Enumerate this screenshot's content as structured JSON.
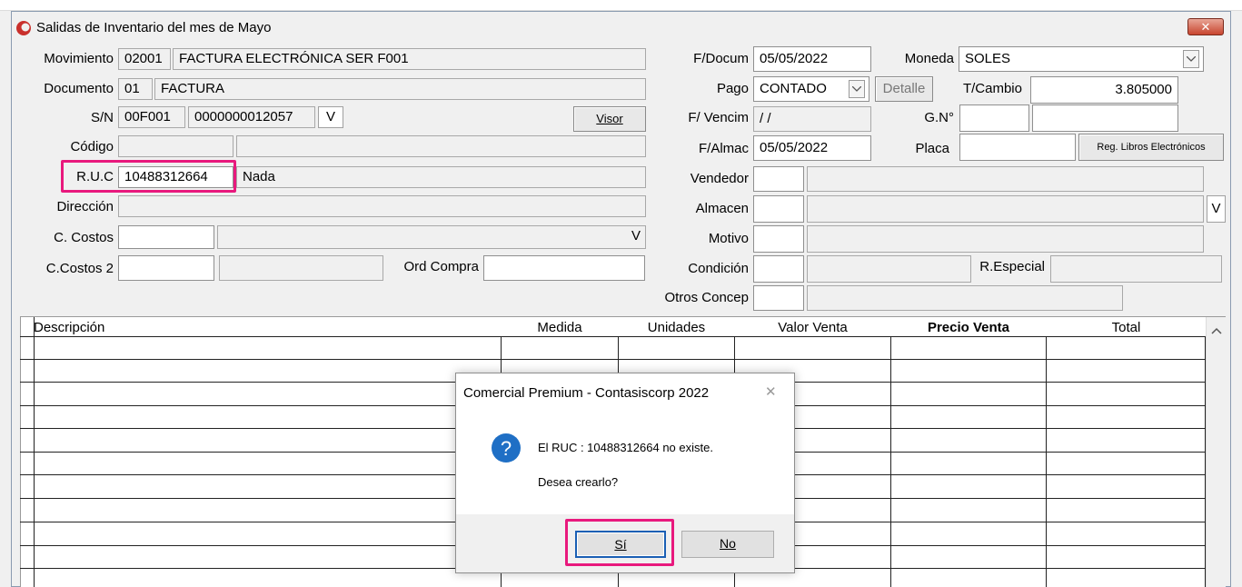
{
  "window": {
    "title": "Salidas de Inventario del mes de Mayo",
    "close": "✕"
  },
  "form": {
    "movimiento": {
      "label": "Movimiento",
      "code": "02001",
      "desc": "FACTURA ELECTRÓNICA SER F001"
    },
    "documento": {
      "label": "Documento",
      "code": "01",
      "desc": "FACTURA"
    },
    "sn": {
      "label": "S/N",
      "serie": "00F001",
      "numero": "0000000012057",
      "btn": "V"
    },
    "visor": "Visor",
    "codigo": {
      "label": "Código",
      "code": "",
      "desc": ""
    },
    "ruc": {
      "label": "R.U.C",
      "value": "10488312664",
      "name": "Nada"
    },
    "direccion": {
      "label": "Dirección",
      "value": ""
    },
    "ccostos": {
      "label": "C. Costos",
      "btn": "V"
    },
    "ccostos2": {
      "label": "C.Costos 2"
    },
    "ord_compra": {
      "label": "Ord Compra",
      "value": ""
    },
    "fdocum": {
      "label": "F/Docum",
      "value": "05/05/2022"
    },
    "moneda": {
      "label": "Moneda",
      "value": "SOLES"
    },
    "pago": {
      "label": "Pago",
      "value": "CONTADO",
      "detalle": "Detalle"
    },
    "tcambio": {
      "label": "T/Cambio",
      "value": "3.805000"
    },
    "fvencim": {
      "label": "F/ Vencim",
      "value": " / /"
    },
    "gn": {
      "label": "G.N°"
    },
    "falmac": {
      "label": "F/Almac",
      "value": "05/05/2022"
    },
    "placa": {
      "label": "Placa",
      "btn": "Reg. Libros Electrónicos"
    },
    "vendedor": {
      "label": "Vendedor"
    },
    "almacen": {
      "label": "Almacen",
      "btn": "V"
    },
    "motivo": {
      "label": "Motivo"
    },
    "condicion": {
      "label": "Condición"
    },
    "respecial": {
      "label": "R.Especial"
    },
    "otros": {
      "label": "Otros Concep"
    }
  },
  "grid": {
    "columns": [
      "Descripción",
      "Medida",
      "Unidades",
      "Valor Venta",
      "Precio Venta",
      "Total"
    ]
  },
  "dialog": {
    "title": "Comercial Premium  - Contasiscorp 2022",
    "close": "✕",
    "message": "El RUC : 10488312664  no existe.",
    "question": "Desea crearlo?",
    "yes": "Sí",
    "no": "No",
    "icon_glyph": "?"
  },
  "colors": {
    "highlight": "#e8197d",
    "dialog_icon": "#1f6fc5"
  }
}
